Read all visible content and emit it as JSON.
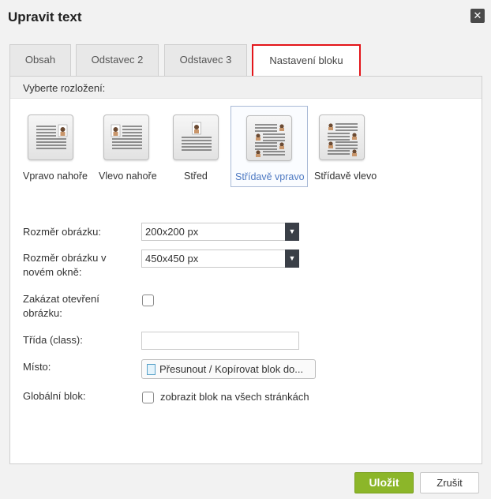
{
  "dialog": {
    "title": "Upravit text",
    "close_icon": "close-icon"
  },
  "tabs": [
    {
      "label": "Obsah",
      "active": false
    },
    {
      "label": "Odstavec 2",
      "active": false
    },
    {
      "label": "Odstavec 3",
      "active": false
    },
    {
      "label": "Nastavení bloku",
      "active": true
    }
  ],
  "layout": {
    "prompt": "Vyberte rozložení:",
    "selected": "Střídavě vpravo",
    "options": [
      {
        "label": "Vpravo nahoře",
        "icon": "layout-image-top-right-icon"
      },
      {
        "label": "Vlevo nahoře",
        "icon": "layout-image-top-left-icon"
      },
      {
        "label": "Střed",
        "icon": "layout-image-center-icon"
      },
      {
        "label": "Střídavě vpravo",
        "icon": "layout-alternate-right-icon"
      },
      {
        "label": "Střídavě vlevo",
        "icon": "layout-alternate-left-icon"
      }
    ]
  },
  "form": {
    "image_size": {
      "label": "Rozměr obrázku:",
      "value": "200x200 px"
    },
    "image_size_new_window": {
      "label_line1": "Rozměr obrázku v",
      "label_line2": "novém okně:",
      "value": "450x450 px"
    },
    "disable_open": {
      "label_line1": "Zakázat otevření",
      "label_line2": "obrázku:",
      "checked": false
    },
    "css_class": {
      "label": "Třída (class):",
      "value": ""
    },
    "place": {
      "label": "Místo:",
      "button": "Přesunout / Kopírovat blok do..."
    },
    "global_block": {
      "label": "Globální blok:",
      "option": "zobrazit blok na všech stránkách",
      "checked": false
    }
  },
  "footer": {
    "save": "Uložit",
    "cancel": "Zrušit"
  },
  "colors": {
    "accent": "#8cb629",
    "tab_highlight": "#e3151a",
    "selected_label": "#4d79c2"
  }
}
